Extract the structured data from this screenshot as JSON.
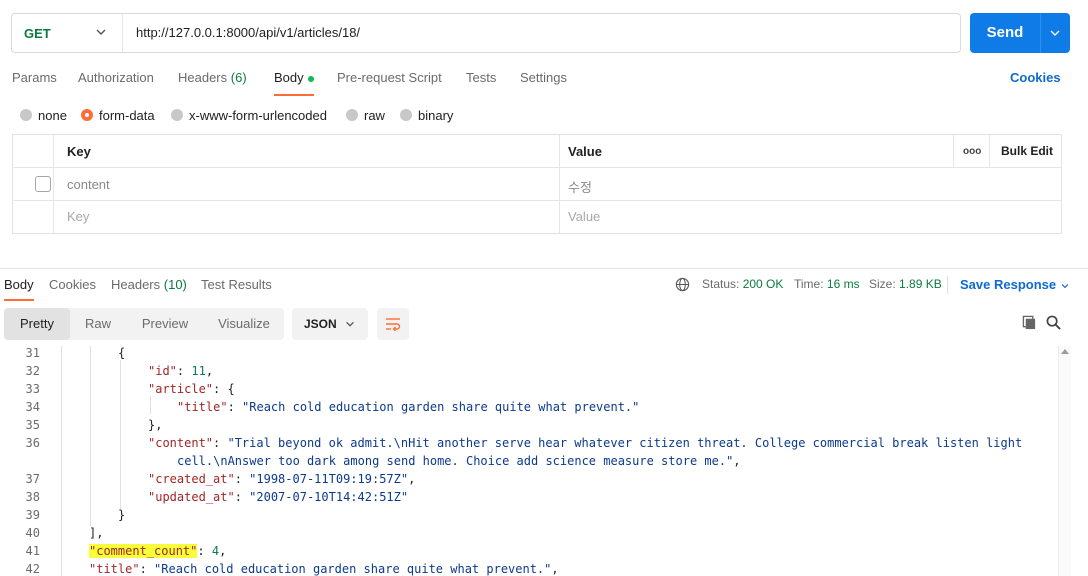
{
  "request": {
    "method": "GET",
    "url": "http://127.0.0.1:8000/api/v1/articles/18/",
    "send_label": "Send"
  },
  "request_tabs": {
    "params": "Params",
    "authorization": "Authorization",
    "headers_label": "Headers",
    "headers_count": "(6)",
    "body": "Body",
    "pre_request": "Pre-request Script",
    "tests": "Tests",
    "settings": "Settings",
    "cookies": "Cookies"
  },
  "body_types": {
    "none": "none",
    "form_data": "form-data",
    "urlencoded": "x-www-form-urlencoded",
    "raw": "raw",
    "binary": "binary",
    "selected": "form-data"
  },
  "form_table": {
    "key_header": "Key",
    "value_header": "Value",
    "more": "ooo",
    "bulk_edit": "Bulk Edit",
    "row_key": "content",
    "row_value": "수정",
    "key_placeholder": "Key",
    "value_placeholder": "Value"
  },
  "response_tabs": {
    "body": "Body",
    "cookies": "Cookies",
    "headers_label": "Headers",
    "headers_count": "(10)",
    "test_results": "Test Results"
  },
  "status": {
    "status_label": "Status:",
    "status_value": "200 OK",
    "time_label": "Time:",
    "time_value": "16 ms",
    "size_label": "Size:",
    "size_value": "1.89 KB",
    "save_response": "Save Response"
  },
  "view": {
    "pretty": "Pretty",
    "raw": "Raw",
    "preview": "Preview",
    "visualize": "Visualize",
    "format": "JSON"
  },
  "code": {
    "l31": "31",
    "l32": "32",
    "l33": "33",
    "l34": "34",
    "l35": "35",
    "l36": "36",
    "l37": "37",
    "l38": "38",
    "l39": "39",
    "l40": "40",
    "l41": "41",
    "l42": "42",
    "id_key": "\"id\"",
    "id_val": "11",
    "article_key": "\"article\"",
    "title_key": "\"title\"",
    "title_val": "\"Reach cold education garden share quite what prevent.\"",
    "content_key": "\"content\"",
    "content_val_1": "\"Trial beyond ok admit.\\nHit another serve hear whatever citizen threat. College commercial break listen light",
    "content_val_2": "cell.\\nAnswer too dark among send home. Choice add science measure store me.\"",
    "created_key": "\"created_at\"",
    "created_val": "\"1998-07-11T09:19:57Z\"",
    "updated_key": "\"updated_at\"",
    "updated_val": "\"2007-07-10T14:42:51Z\"",
    "comment_count_key": "\"comment_count\"",
    "comment_count_val": "4",
    "title2_key": "\"title\"",
    "title2_val": "\"Reach cold education garden share quite what prevent.\""
  },
  "colors": {
    "accent": "#ff6c37",
    "send": "#0e7be6",
    "method": "#0b7a3e",
    "highlight": "#f8ff3a"
  }
}
